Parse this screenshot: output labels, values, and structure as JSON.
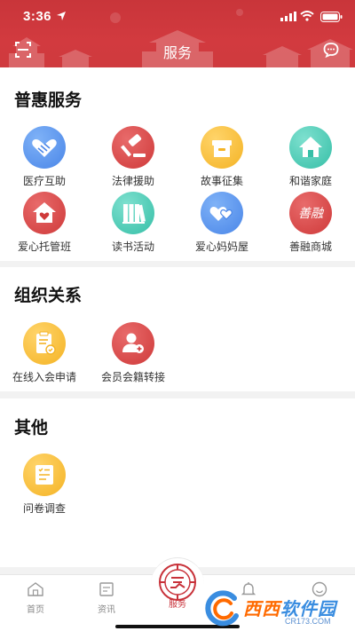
{
  "status_bar": {
    "time": "3:36"
  },
  "nav": {
    "title": "服务"
  },
  "sections": [
    {
      "title": "普惠服务",
      "items": [
        {
          "label": "医疗互助",
          "icon": "handshake-heart-icon",
          "color": "#4a86e8"
        },
        {
          "label": "法律援助",
          "icon": "gavel-icon",
          "color": "#cf3a3a"
        },
        {
          "label": "故事征集",
          "icon": "box-icon",
          "color": "#f4b324"
        },
        {
          "label": "和谐家庭",
          "icon": "house-icon",
          "color": "#36bfa7"
        },
        {
          "label": "爱心托管班",
          "icon": "house-heart-icon",
          "color": "#cf3a3a"
        },
        {
          "label": "读书活动",
          "icon": "books-icon",
          "color": "#36bfa7"
        },
        {
          "label": "爱心妈妈屋",
          "icon": "hearts-icon",
          "color": "#4a86e8"
        },
        {
          "label": "善融商城",
          "icon": "shanrong-logo-icon",
          "logo_text": "善融",
          "color": "#cf3a3a"
        }
      ]
    },
    {
      "title": "组织关系",
      "items": [
        {
          "label": "在线入会申请",
          "icon": "clipboard-form-icon",
          "color": "#f4b324"
        },
        {
          "label": "会员会籍转接",
          "icon": "user-add-icon",
          "color": "#cf3a3a"
        }
      ]
    },
    {
      "title": "其他",
      "items": [
        {
          "label": "问卷调查",
          "icon": "checklist-icon",
          "color": "#f4b324"
        }
      ]
    }
  ],
  "tabbar": {
    "tabs": [
      {
        "label": "首页",
        "icon": "home-icon"
      },
      {
        "label": "资讯",
        "icon": "news-icon"
      },
      {
        "label": "服务",
        "icon": "service-emblem-icon",
        "active": true
      },
      {
        "label": "",
        "icon": "bell-icon"
      },
      {
        "label": "",
        "icon": "profile-icon"
      }
    ]
  },
  "watermark": {
    "text_a": "西西",
    "text_b": "软件园",
    "site": "CR173.COM"
  },
  "colors": {
    "brand_red": "#c8323a",
    "text_dark": "#222222",
    "divider": "#f2f2f2"
  }
}
